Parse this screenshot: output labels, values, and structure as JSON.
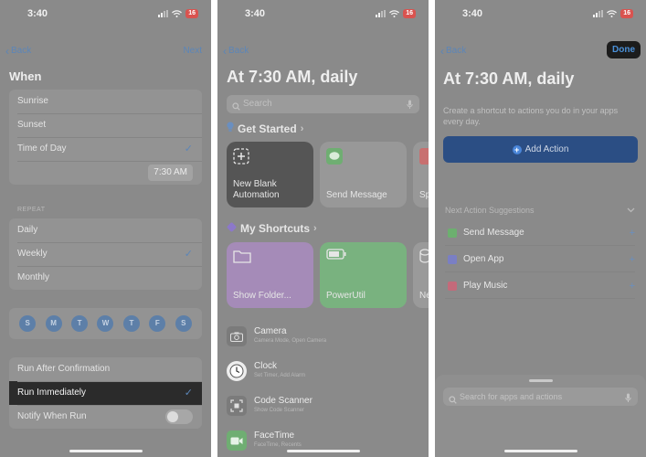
{
  "status": {
    "time": "3:40",
    "battery": "16"
  },
  "panel1": {
    "back": "Back",
    "next": "Next",
    "title": "When",
    "when_options": [
      {
        "label": "Sunrise",
        "checked": false
      },
      {
        "label": "Sunset",
        "checked": false
      },
      {
        "label": "Time of Day",
        "checked": true
      }
    ],
    "time_value": "7:30 AM",
    "repeat_label": "REPEAT",
    "repeat_options": [
      {
        "label": "Daily",
        "checked": false
      },
      {
        "label": "Weekly",
        "checked": true
      },
      {
        "label": "Monthly",
        "checked": false
      }
    ],
    "days": [
      "S",
      "M",
      "T",
      "W",
      "T",
      "F",
      "S"
    ],
    "run_options": [
      {
        "label": "Run After Confirmation",
        "checked": false
      },
      {
        "label": "Run Immediately",
        "checked": true
      },
      {
        "label": "Notify When Run",
        "toggle": false
      }
    ]
  },
  "panel2": {
    "back": "Back",
    "title": "At 7:30 AM, daily",
    "search_placeholder": "Search",
    "get_started": "Get Started",
    "starter_tiles": [
      {
        "label": "New Blank Automation",
        "icon": "plus-square-icon"
      },
      {
        "label": "Send Message",
        "icon": "message-icon"
      },
      {
        "label": "Sp",
        "icon": "speaker-icon"
      }
    ],
    "my_shortcuts": "My Shortcuts",
    "shortcut_tiles": [
      {
        "label": "Show Folder...",
        "color": "#a58bb8",
        "icon": "folder-icon"
      },
      {
        "label": "PowerUtil",
        "color": "#79b27f",
        "icon": "battery-icon"
      },
      {
        "label": "Ne",
        "color": "#9a9a9a",
        "icon": "stack-icon"
      }
    ],
    "apps": [
      {
        "title": "Camera",
        "subtitle": "Camera Mode, Open Camera",
        "icon": "camera-icon"
      },
      {
        "title": "Clock",
        "subtitle": "Set Timer, Add Alarm",
        "icon": "clock-icon"
      },
      {
        "title": "Code Scanner",
        "subtitle": "Show Code Scanner",
        "icon": "scanner-icon"
      },
      {
        "title": "FaceTime",
        "subtitle": "FaceTime, Recents",
        "icon": "facetime-icon"
      }
    ]
  },
  "panel3": {
    "back": "Back",
    "done": "Done",
    "title": "At 7:30 AM, daily",
    "description": "Create a shortcut to actions you do in your apps every day.",
    "add_action": "Add Action",
    "suggestions_header": "Next Action Suggestions",
    "suggestions": [
      {
        "label": "Send Message",
        "color": "#6cb06f"
      },
      {
        "label": "Open App",
        "color": "#7a7fc4"
      },
      {
        "label": "Play Music",
        "color": "#c46a7a"
      }
    ],
    "search_placeholder": "Search for apps and actions"
  }
}
